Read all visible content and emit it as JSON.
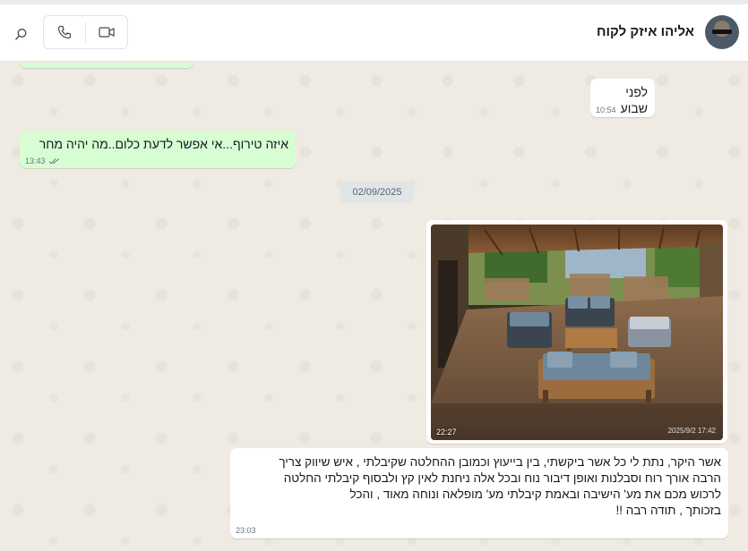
{
  "header": {
    "contact_name": "אליהו איזק לקוח",
    "icons": {
      "avatar": "contact-avatar",
      "video": "video-call-icon",
      "voice": "voice-call-icon",
      "search": "search-icon"
    }
  },
  "messages": [
    {
      "direction": "in",
      "text": "לפני שבוע",
      "time": "10:54"
    },
    {
      "direction": "out",
      "text": "איזה טירוף...אי אפשר לדעת כלום..מה יהיה מחר",
      "time": "13:43",
      "status": "read-ticks"
    }
  ],
  "date_divider": "02/09/2025",
  "photo_message": {
    "time": "22:27",
    "image_stamp": "2025/9/2 17:42"
  },
  "long_message": {
    "text": "אשר היקר, נתת לי כל אשר ביקשתי, בין בייעוץ וכמובן ההחלטה שקיבלתי , איש שיווק צריך\nהרבה אורך רוח וסבלנות ואופן דיבור נוח ובכל אלה ניחנת לאין קץ ולבסוף קיבלתי החלטה\nלרכוש מכם את מע' הישיבה ובאמת קיבלתי מע' מופלאה ונוחה מאוד , והכל\nבזכותך , תודה רבה !!",
    "time": "23:03"
  },
  "colors": {
    "outgoing_bubble": "#d9fdd3",
    "incoming_bubble": "#ffffff",
    "chat_background": "#efeae2"
  }
}
